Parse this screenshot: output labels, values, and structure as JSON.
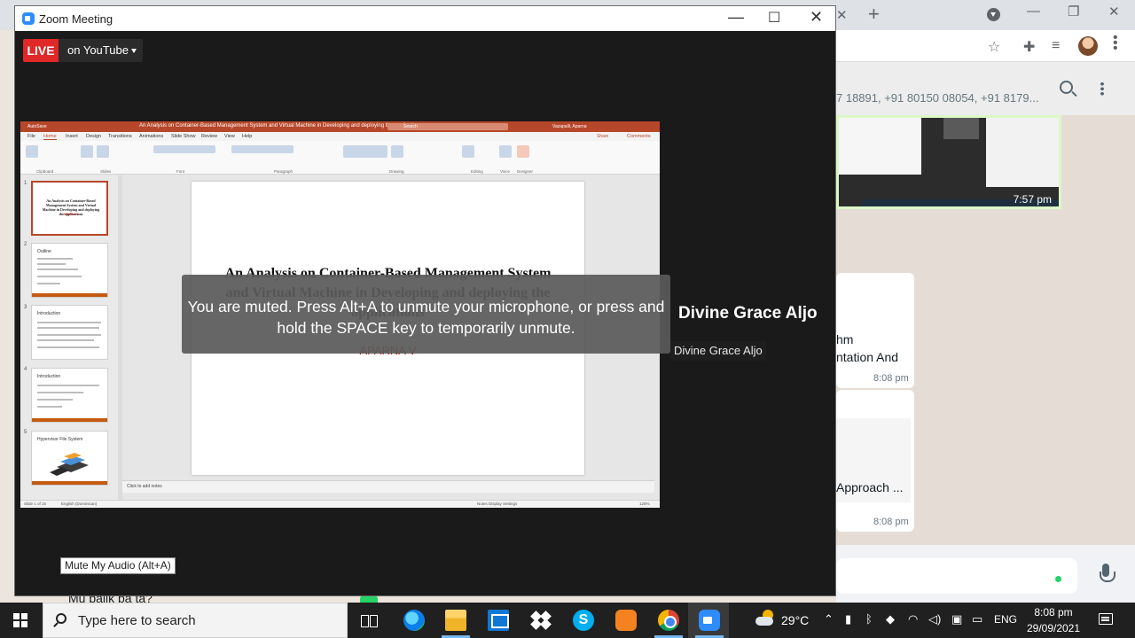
{
  "colors": {
    "zoom_bg": "#1a1a1a",
    "live_red": "#e02828",
    "ppt_accent": "#b7472a",
    "slide_author": "#c00000",
    "taskbar": "#202020",
    "whatsapp_chat": "#e5ddd5"
  },
  "zoom": {
    "title": "Zoom Meeting",
    "live_label": "LIVE",
    "stream_label": "on YouTube",
    "muted_message": "You are muted. Press Alt+A to unmute your microphone, or press and hold the SPACE key to temporarily unmute.",
    "participant_name": "Divine Grace Aljo",
    "participant_tag": "Divine Grace Aljo",
    "mute_tooltip": "Mute My Audio (Alt+A)",
    "icons": [
      "zoom-logo-icon",
      "minimize-icon",
      "maximize-icon",
      "close-icon",
      "caret-down-icon"
    ]
  },
  "ppt": {
    "doc_title": "An Analysis on Container-Based Management System and Virtual Machine in Developing and deploying the applications",
    "autosave": "AutoSave",
    "search": "Search",
    "user": "Vazapalli, Aparna",
    "menu": [
      "File",
      "Home",
      "Insert",
      "Design",
      "Transitions",
      "Animations",
      "Slide Show",
      "Review",
      "View",
      "Help"
    ],
    "share": "Share",
    "comments": "Comments",
    "ribbon_groups": [
      "Clipboard",
      "Slides",
      "Font",
      "Paragraph",
      "Drawing",
      "Editing",
      "Voice",
      "Designer"
    ],
    "slide": {
      "title": "An Analysis on Container-Based Management System and Virtual Machine in Developing and deploying the applications",
      "author": "APARNA V"
    },
    "thumbs": [
      {
        "num": "1",
        "title": "An Analysis on Container-Based Management System and Virtual Machine in Developing and deploying the applications",
        "author": "APARNA V"
      },
      {
        "num": "2",
        "title": "Outline"
      },
      {
        "num": "3",
        "title": "Introduction"
      },
      {
        "num": "4",
        "title": "Introduction"
      },
      {
        "num": "5",
        "title": "Hypervisor File System"
      }
    ],
    "notes": "Click to add notes",
    "status_slide": "Slide 1 of 16",
    "status_lang": "English (Dominican)",
    "status_right": "Notes    Display Settings",
    "zoom_level": "125%"
  },
  "browser": {
    "whatsapp_phones": "7 18891, +91 80150 08054, +91 8179...",
    "thumb_time": "7:57 pm",
    "msg1_line1": "hm",
    "msg1_line2": "ntation And",
    "msg1_time": "8:08 pm",
    "msg2_text": "Approach ...",
    "msg2_time": "8:08 pm",
    "bottom_text": "Mu balik pa ta?",
    "icons": [
      "star-icon",
      "extensions-icon",
      "reading-list-icon",
      "avatar",
      "menu-icon",
      "search-icon",
      "mic-icon"
    ]
  },
  "taskbar": {
    "search_placeholder": "Type here to search",
    "temperature": "29°C",
    "language": "ENG",
    "time": "8:08 pm",
    "date": "29/09/2021",
    "apps": [
      "task-view-icon",
      "edge-icon",
      "file-explorer-icon",
      "mail-icon",
      "dropbox-icon",
      "skype-icon",
      "brave-icon",
      "chrome-icon",
      "zoom-icon"
    ]
  }
}
